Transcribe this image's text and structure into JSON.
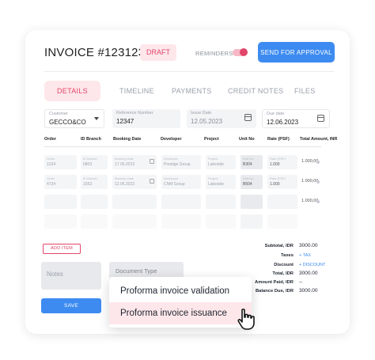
{
  "header": {
    "title": "INVOICE #123123",
    "status_badge": "DRAFT",
    "reminders_label": "REMINDERS",
    "reminders_on": true,
    "approve_button": "SEND FOR APPROVAL"
  },
  "tabs": [
    {
      "label": "DETAILS",
      "active": true
    },
    {
      "label": "TIMELINE",
      "active": false
    },
    {
      "label": "PAYMENTS",
      "active": false
    },
    {
      "label": "CREDIT NOTES",
      "active": false
    },
    {
      "label": "FILES",
      "active": false
    }
  ],
  "fields": {
    "customer": {
      "label": "Customer",
      "value": "GECCO&CO"
    },
    "reference": {
      "label": "Reference Number",
      "value": "12347"
    },
    "issue_date": {
      "label": "Issue Date",
      "value": "12.05.2023"
    },
    "due_date": {
      "label": "Due date",
      "value": "12.06.2023"
    }
  },
  "table": {
    "headers": [
      "Order",
      "ID Branch",
      "Booking Date",
      "Developer",
      "Project",
      "Unit No",
      "Rate (PSF)",
      "Total Amount, INR"
    ],
    "rows": [
      {
        "cells": [
          {
            "label": "Order",
            "value": "1234"
          },
          {
            "label": "ID Branch",
            "value": "6803"
          },
          {
            "label": "Booking Date",
            "value": "17.05.2023"
          },
          {
            "label": "Developer",
            "value": "Prestige Group"
          },
          {
            "label": "Project",
            "value": "Lakeside"
          },
          {
            "label": "Unit No",
            "value": "B304"
          },
          {
            "label": "Rate (PSF)",
            "value": "1.000"
          }
        ],
        "total": "1.000,00"
      },
      {
        "cells": [
          {
            "label": "Order",
            "value": "4734"
          },
          {
            "label": "ID Branch",
            "value": "1563"
          },
          {
            "label": "Booking Date",
            "value": "12.05.2023"
          },
          {
            "label": "Developer",
            "value": "CNM Group"
          },
          {
            "label": "Project",
            "value": "Lakeside"
          },
          {
            "label": "Unit No",
            "value": "B504"
          },
          {
            "label": "Rate (PSF)",
            "value": "1.000"
          }
        ],
        "total": "1.000,00"
      },
      {
        "cells": [
          {
            "label": "",
            "value": ""
          },
          {
            "label": "",
            "value": ""
          },
          {
            "label": "",
            "value": ""
          },
          {
            "label": "",
            "value": ""
          },
          {
            "label": "",
            "value": ""
          },
          {
            "label": "",
            "value": ""
          },
          {
            "label": "",
            "value": ""
          }
        ],
        "total": "1.000,00"
      }
    ]
  },
  "add_item_button": "ADD ITEM",
  "notes_placeholder": "Notes",
  "document_type": {
    "label": "Document Type"
  },
  "save_button": "SAVE",
  "summary": [
    {
      "label": "Subtotal, IDR",
      "value": "3000.00",
      "link": false
    },
    {
      "label": "Taxes",
      "value": "+ TAX",
      "link": true
    },
    {
      "label": "Discount",
      "value": "+ DISCOUNT",
      "link": true
    },
    {
      "label": "Total, IDR",
      "value": "3000.00",
      "link": false
    },
    {
      "label": "Amount Paid, IDR",
      "value": "--",
      "link": false
    },
    {
      "label": "Balance Due, IDR",
      "value": "3000.00",
      "link": false
    }
  ],
  "dropdown_options": [
    {
      "label": "Proforma invoice validation",
      "highlighted": false
    },
    {
      "label": "Proforma invoice issuance",
      "highlighted": true
    }
  ],
  "colors": {
    "accent_blue": "#3d8bf1",
    "accent_pink": "#e2456a",
    "pink_bg": "#fde7ea"
  }
}
